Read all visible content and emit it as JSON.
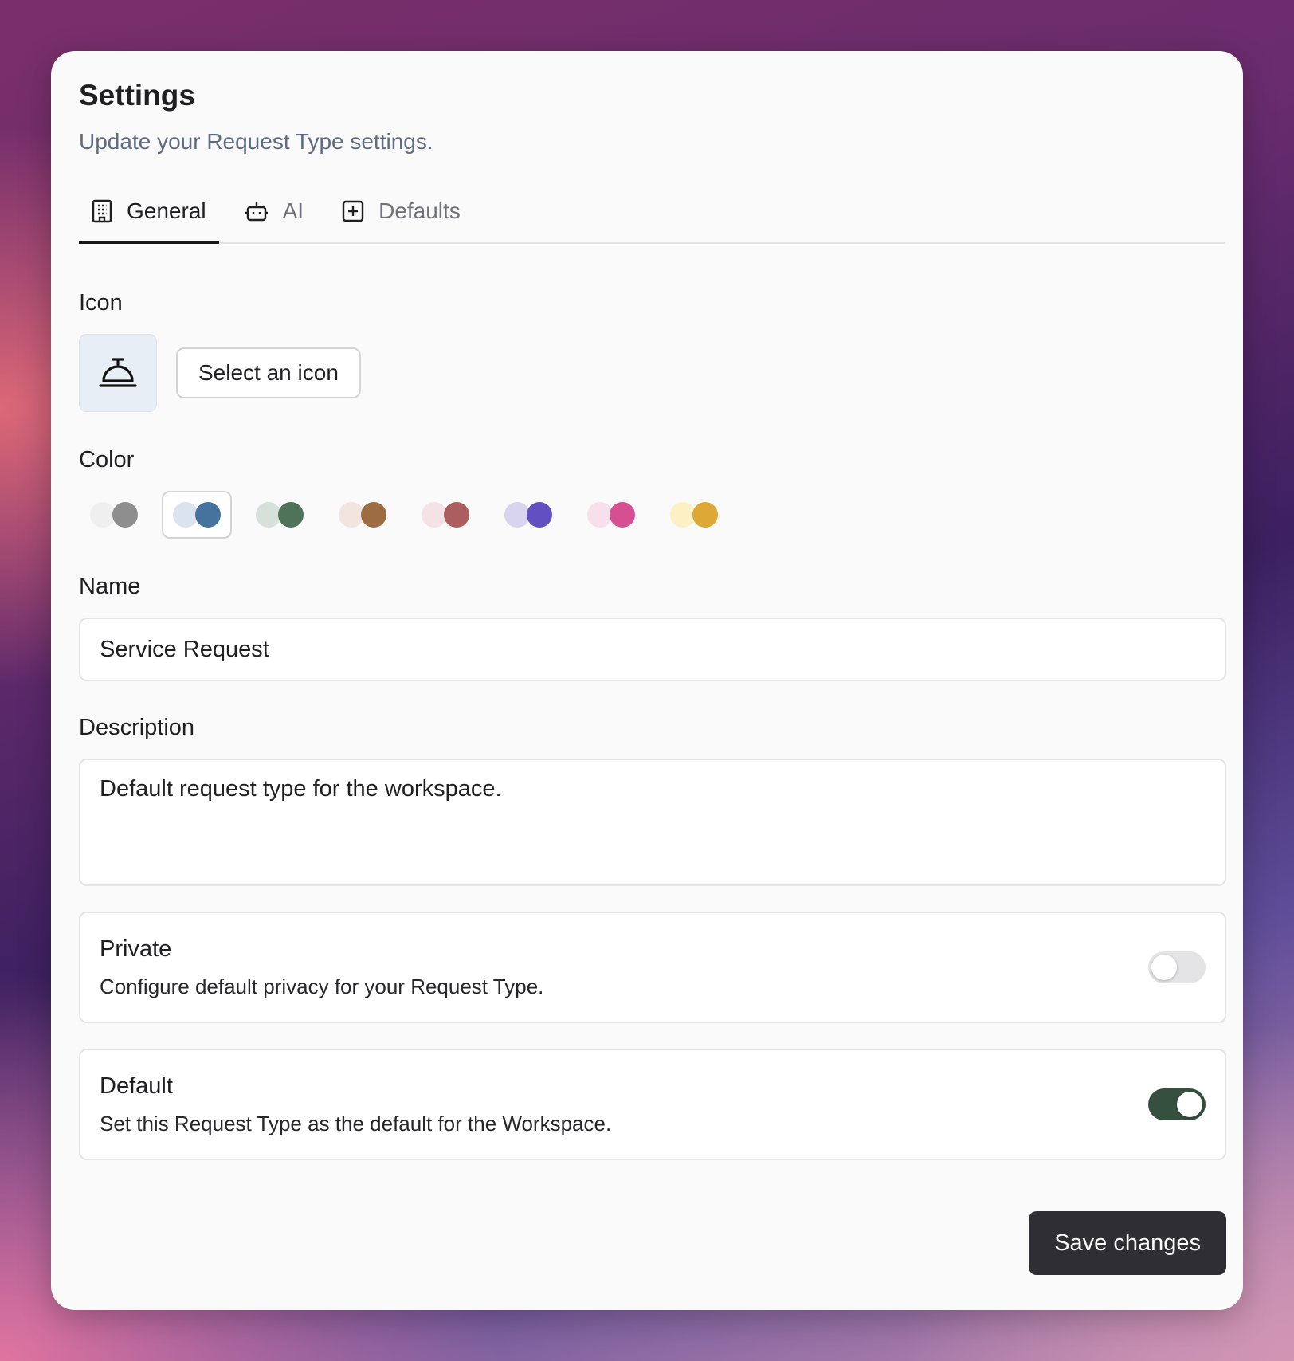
{
  "header": {
    "title": "Settings",
    "subtitle": "Update your Request Type settings."
  },
  "tabs": [
    {
      "label": "General",
      "icon": "building-icon",
      "active": true
    },
    {
      "label": "AI",
      "icon": "bot-icon",
      "active": false
    },
    {
      "label": "Defaults",
      "icon": "plus-square-icon",
      "active": false
    }
  ],
  "icon_section": {
    "label": "Icon",
    "current_icon": "concierge-bell-icon",
    "select_label": "Select an icon"
  },
  "color_section": {
    "label": "Color",
    "swatches": [
      {
        "name": "gray",
        "light": "#efefef",
        "dark": "#8e8e8e",
        "selected": false
      },
      {
        "name": "blue",
        "light": "#dbe4ee",
        "dark": "#46729e",
        "selected": true
      },
      {
        "name": "green",
        "light": "#d6e1da",
        "dark": "#4f7359",
        "selected": false
      },
      {
        "name": "brown",
        "light": "#f2e4de",
        "dark": "#9c6c42",
        "selected": false
      },
      {
        "name": "red",
        "light": "#f4e3e5",
        "dark": "#ac5d5d",
        "selected": false
      },
      {
        "name": "purple",
        "light": "#d8d3ee",
        "dark": "#6250c2",
        "selected": false
      },
      {
        "name": "pink",
        "light": "#f7dfec",
        "dark": "#d64f92",
        "selected": false
      },
      {
        "name": "yellow",
        "light": "#fbf1c4",
        "dark": "#dda836",
        "selected": false
      }
    ]
  },
  "name_section": {
    "label": "Name",
    "value": "Service Request"
  },
  "description_section": {
    "label": "Description",
    "value": "Default request type for the workspace."
  },
  "private_option": {
    "title": "Private",
    "description": "Configure default privacy for your Request Type.",
    "enabled": false
  },
  "default_option": {
    "title": "Default",
    "description": "Set this Request Type as the default for the Workspace.",
    "enabled": true
  },
  "footer": {
    "save_label": "Save changes"
  },
  "colors": {
    "accent_toggle_on": "#36503f",
    "primary_button": "#2f2f33"
  }
}
